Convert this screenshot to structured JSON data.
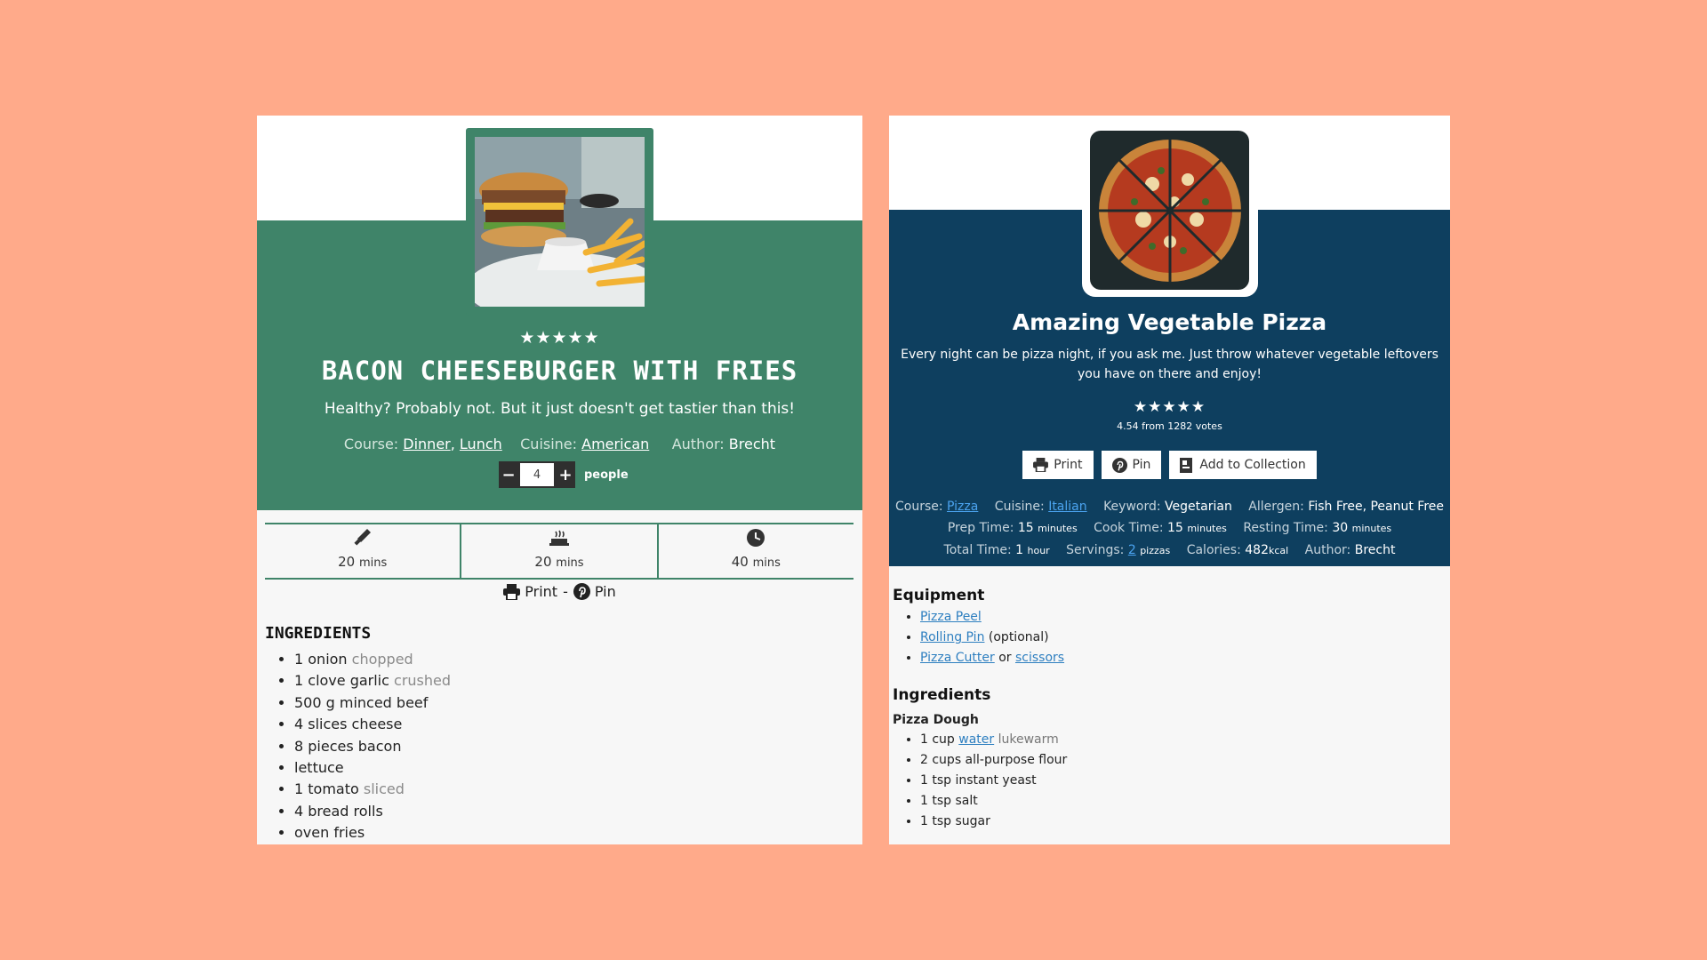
{
  "card1": {
    "rating": "★★★★★",
    "title": "BACON CHEESEBURGER WITH FRIES",
    "summary": "Healthy? Probably not. But it just doesn't get tastier than this!",
    "meta": {
      "course_label": "Course:",
      "course_1": "Dinner",
      "course_sep": ",",
      "course_2": "Lunch",
      "cuisine_label": "Cuisine:",
      "cuisine": "American",
      "author_label": "Author:",
      "author": "Brecht"
    },
    "servings": {
      "minus": "−",
      "value": "4",
      "plus": "+",
      "unit": "people"
    },
    "times": [
      {
        "icon": "knife-icon",
        "value": "20",
        "unit": "mins"
      },
      {
        "icon": "pot-icon",
        "value": "20",
        "unit": "mins"
      },
      {
        "icon": "clock-icon",
        "value": "40",
        "unit": "mins"
      }
    ],
    "actions": {
      "print": "Print",
      "sep": "-",
      "pin": "Pin"
    },
    "ingredients_title": "INGREDIENTS",
    "ingredients": [
      {
        "text": "1 onion",
        "note": "chopped"
      },
      {
        "text": "1 clove garlic",
        "note": "crushed"
      },
      {
        "text": "500 g minced beef",
        "note": ""
      },
      {
        "text": "4 slices cheese",
        "note": ""
      },
      {
        "text": "8 pieces bacon",
        "note": ""
      },
      {
        "text": "lettuce",
        "note": ""
      },
      {
        "text": "1 tomato",
        "note": "sliced"
      },
      {
        "text": "4 bread rolls",
        "note": ""
      },
      {
        "text": "oven fries",
        "note": ""
      }
    ],
    "colors": {
      "accent": "#3f8469"
    }
  },
  "card2": {
    "title": "Amazing Vegetable Pizza",
    "summary": "Every night can be pizza night, if you ask me. Just throw whatever vegetable leftovers you have on there and enjoy!",
    "rating": "★★★★★",
    "votes": "4.54 from 1282 votes",
    "buttons": {
      "print": "Print",
      "pin": "Pin",
      "collection": "Add to Collection"
    },
    "meta": {
      "course_label": "Course:",
      "course": "Pizza",
      "cuisine_label": "Cuisine:",
      "cuisine": "Italian",
      "keyword_label": "Keyword:",
      "keyword": "Vegetarian",
      "allergen_label": "Allergen:",
      "allergen": "Fish Free, Peanut Free",
      "prep_label": "Prep Time:",
      "prep_value": "15",
      "prep_unit": "minutes",
      "cook_label": "Cook Time:",
      "cook_value": "15",
      "cook_unit": "minutes",
      "rest_label": "Resting Time:",
      "rest_value": "30",
      "rest_unit": "minutes",
      "total_label": "Total Time:",
      "total_value": "1",
      "total_unit": "hour",
      "servings_label": "Servings:",
      "servings_value": "2",
      "servings_unit": "pizzas",
      "calories_label": "Calories:",
      "calories_value": "482",
      "calories_unit": "kcal",
      "author_label": "Author:",
      "author": "Brecht"
    },
    "equipment_title": "Equipment",
    "equipment": {
      "item1": "Pizza Peel",
      "item2": "Rolling Pin",
      "item2_note": "(optional)",
      "item3": "Pizza Cutter",
      "item3_or": "or",
      "item3_alt": "scissors"
    },
    "ingredients_title": "Ingredients",
    "group_title": "Pizza Dough",
    "ingredients": {
      "i1_qty": "1 cup",
      "i1_link": "water",
      "i1_note": "lukewarm",
      "i2": "2 cups all-purpose flour",
      "i3": "1 tsp instant yeast",
      "i4": "1 tsp salt",
      "i5": "1 tsp sugar"
    },
    "colors": {
      "header": "#0e3f5f",
      "link": "#4ba3ef"
    }
  },
  "background_color": "#ffaa8a"
}
